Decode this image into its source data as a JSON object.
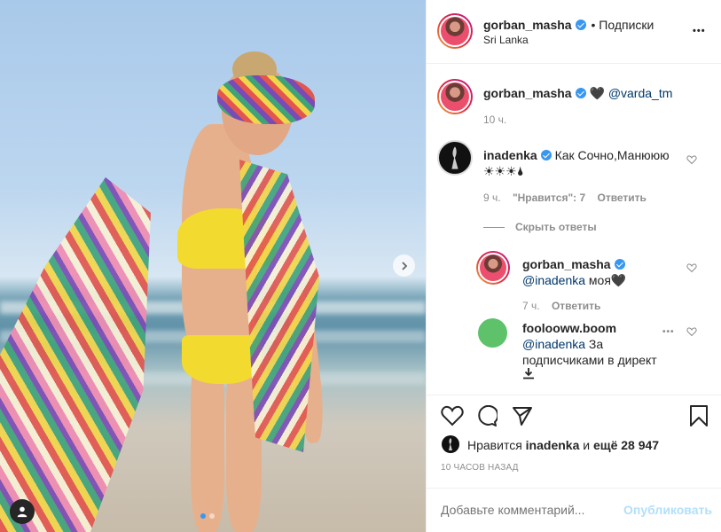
{
  "post": {
    "author": "gorban_masha",
    "follow_separator": "•",
    "follow_label": "Подписки",
    "location": "Sri Lanka",
    "more_label": "•••"
  },
  "caption": {
    "author": "gorban_masha",
    "text_emoji": "🖤",
    "mention": "@varda_tm",
    "time": "10 ч."
  },
  "comments": [
    {
      "author": "inadenka",
      "text": "Как Сочно,Манююю",
      "text2": "☀☀☀🌢",
      "time": "9 ч.",
      "likes": "\"Нравится\": 7",
      "reply_label": "Ответить",
      "hide_replies": "Скрыть ответы"
    }
  ],
  "replies": [
    {
      "author": "gorban_masha",
      "mention": "@inadenka",
      "text": " моя🖤",
      "time": "7 ч.",
      "reply_label": "Ответить"
    },
    {
      "author": "foolooww.boom",
      "mention": "@inadenka",
      "text_line1": " За",
      "text_line2": "подписчиками в директ",
      "more": "•••"
    }
  ],
  "likes_row": {
    "prefix": "Нравится",
    "user": "inadenka",
    "middle": "и",
    "count": "ещё 28 947"
  },
  "timestamp": "10 ЧАСОВ НАЗАД",
  "add_comment": {
    "placeholder": "Добавьте комментарий...",
    "publish": "Опубликовать"
  },
  "colors": {
    "accent": "#3897f0",
    "publish_disabled": "#b2dffc",
    "avatar_green": "#5ec26a"
  }
}
